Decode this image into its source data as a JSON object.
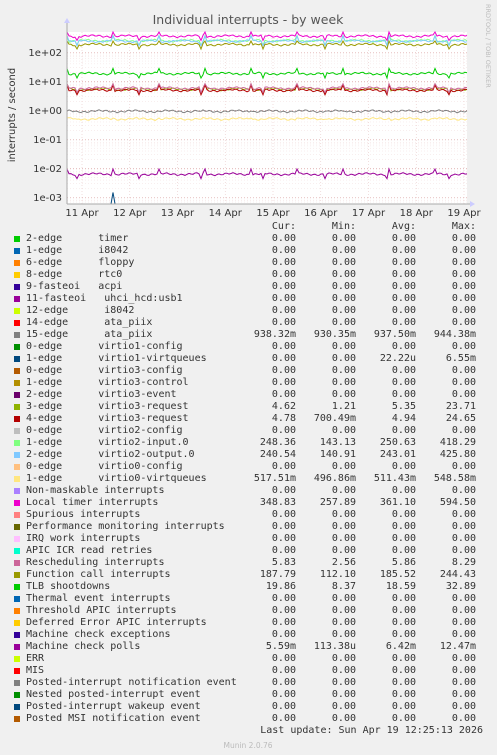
{
  "chart_data": {
    "type": "line",
    "title": "Individual interrupts - by week",
    "ylabel": "interrupts / second",
    "yscale": "log",
    "ylim": [
      0.0006,
      500
    ],
    "y_ticks": [
      {
        "value": 100,
        "label": "1e+02"
      },
      {
        "value": 10,
        "label": "1e+01"
      },
      {
        "value": 1,
        "label": "1e+00"
      },
      {
        "value": 0.1,
        "label": "1e-01"
      },
      {
        "value": 0.01,
        "label": "1e-02"
      },
      {
        "value": 0.001,
        "label": "1e-03"
      }
    ],
    "x_ticks": [
      "11 Apr",
      "12 Apr",
      "13 Apr",
      "14 Apr",
      "15 Apr",
      "16 Apr",
      "17 Apr",
      "18 Apr",
      "19 Apr"
    ],
    "grid": true,
    "side_label": "RRDTOOL / TOBI OETIKER",
    "columns": [
      "Cur:",
      "Min:",
      "Avg:",
      "Max:"
    ],
    "series": [
      {
        "name": "2-edge      timer",
        "color": "#00cc00",
        "values": [
          "0.00",
          "0.00",
          "0.00",
          "0.00"
        ]
      },
      {
        "name": "1-edge      i8042",
        "color": "#0066b3",
        "values": [
          "0.00",
          "0.00",
          "0.00",
          "0.00"
        ]
      },
      {
        "name": "6-edge      floppy",
        "color": "#ff8000",
        "values": [
          "0.00",
          "0.00",
          "0.00",
          "0.00"
        ]
      },
      {
        "name": "8-edge      rtc0",
        "color": "#ffcc00",
        "values": [
          "0.00",
          "0.00",
          "0.00",
          "0.00"
        ]
      },
      {
        "name": "9-fasteoi   acpi",
        "color": "#330099",
        "values": [
          "0.00",
          "0.00",
          "0.00",
          "0.00"
        ]
      },
      {
        "name": "11-fasteoi   uhci_hcd:usb1",
        "color": "#990099",
        "values": [
          "0.00",
          "0.00",
          "0.00",
          "0.00"
        ]
      },
      {
        "name": "12-edge      i8042",
        "color": "#ccff00",
        "values": [
          "0.00",
          "0.00",
          "0.00",
          "0.00"
        ]
      },
      {
        "name": "14-edge      ata_piix",
        "color": "#ff0000",
        "values": [
          "0.00",
          "0.00",
          "0.00",
          "0.00"
        ]
      },
      {
        "name": "15-edge      ata_piix",
        "color": "#808080",
        "values": [
          "938.32m",
          "930.35m",
          "937.50m",
          "944.38m"
        ]
      },
      {
        "name": "0-edge      virtio1-config",
        "color": "#008f00",
        "values": [
          "0.00",
          "0.00",
          "0.00",
          "0.00"
        ]
      },
      {
        "name": "1-edge      virtio1-virtqueues",
        "color": "#00487d",
        "values": [
          "0.00",
          "0.00",
          "22.22u",
          "6.55m"
        ]
      },
      {
        "name": "0-edge      virtio3-config",
        "color": "#b35a00",
        "values": [
          "0.00",
          "0.00",
          "0.00",
          "0.00"
        ]
      },
      {
        "name": "1-edge      virtio3-control",
        "color": "#b38f00",
        "values": [
          "0.00",
          "0.00",
          "0.00",
          "0.00"
        ]
      },
      {
        "name": "2-edge      virtio3-event",
        "color": "#6b006b",
        "values": [
          "0.00",
          "0.00",
          "0.00",
          "0.00"
        ]
      },
      {
        "name": "3-edge      virtio3-request",
        "color": "#8fb300",
        "values": [
          "4.62",
          "1.21",
          "5.35",
          "23.71"
        ]
      },
      {
        "name": "4-edge      virtio3-request",
        "color": "#b30000",
        "values": [
          "4.78",
          "700.49m",
          "4.94",
          "24.65"
        ]
      },
      {
        "name": "0-edge      virtio2-config",
        "color": "#bebebe",
        "values": [
          "0.00",
          "0.00",
          "0.00",
          "0.00"
        ]
      },
      {
        "name": "1-edge      virtio2-input.0",
        "color": "#80ff80",
        "values": [
          "248.36",
          "143.13",
          "250.63",
          "418.29"
        ]
      },
      {
        "name": "2-edge      virtio2-output.0",
        "color": "#80c9ff",
        "values": [
          "240.54",
          "140.91",
          "243.01",
          "425.80"
        ]
      },
      {
        "name": "0-edge      virtio0-config",
        "color": "#ffc080",
        "values": [
          "0.00",
          "0.00",
          "0.00",
          "0.00"
        ]
      },
      {
        "name": "1-edge      virtio0-virtqueues",
        "color": "#ffe680",
        "values": [
          "517.51m",
          "496.86m",
          "511.43m",
          "548.58m"
        ]
      },
      {
        "name": "Non-maskable interrupts",
        "color": "#aa80ff",
        "values": [
          "0.00",
          "0.00",
          "0.00",
          "0.00"
        ]
      },
      {
        "name": "Local timer interrupts",
        "color": "#ee00cc",
        "values": [
          "348.83",
          "257.89",
          "361.10",
          "594.50"
        ]
      },
      {
        "name": "Spurious interrupts",
        "color": "#ff8080",
        "values": [
          "0.00",
          "0.00",
          "0.00",
          "0.00"
        ]
      },
      {
        "name": "Performance monitoring interrupts",
        "color": "#666600",
        "values": [
          "0.00",
          "0.00",
          "0.00",
          "0.00"
        ]
      },
      {
        "name": "IRQ work interrupts",
        "color": "#ffbfff",
        "values": [
          "0.00",
          "0.00",
          "0.00",
          "0.00"
        ]
      },
      {
        "name": "APIC ICR read retries",
        "color": "#00ffcc",
        "values": [
          "0.00",
          "0.00",
          "0.00",
          "0.00"
        ]
      },
      {
        "name": "Rescheduling interrupts",
        "color": "#cc6699",
        "values": [
          "5.83",
          "2.56",
          "5.86",
          "8.29"
        ]
      },
      {
        "name": "Function call interrupts",
        "color": "#999900",
        "values": [
          "187.79",
          "112.10",
          "185.52",
          "244.43"
        ]
      },
      {
        "name": "TLB shootdowns",
        "color": "#00cc00",
        "values": [
          "19.86",
          "8.37",
          "18.59",
          "32.89"
        ]
      },
      {
        "name": "Thermal event interrupts",
        "color": "#0066b3",
        "values": [
          "0.00",
          "0.00",
          "0.00",
          "0.00"
        ]
      },
      {
        "name": "Threshold APIC interrupts",
        "color": "#ff8000",
        "values": [
          "0.00",
          "0.00",
          "0.00",
          "0.00"
        ]
      },
      {
        "name": "Deferred Error APIC interrupts",
        "color": "#ffcc00",
        "values": [
          "0.00",
          "0.00",
          "0.00",
          "0.00"
        ]
      },
      {
        "name": "Machine check exceptions",
        "color": "#330099",
        "values": [
          "0.00",
          "0.00",
          "0.00",
          "0.00"
        ]
      },
      {
        "name": "Machine check polls",
        "color": "#990099",
        "values": [
          "5.59m",
          "113.38u",
          "6.42m",
          "12.47m"
        ]
      },
      {
        "name": "ERR",
        "color": "#ccff00",
        "values": [
          "0.00",
          "0.00",
          "0.00",
          "0.00"
        ]
      },
      {
        "name": "MIS",
        "color": "#ff0000",
        "values": [
          "0.00",
          "0.00",
          "0.00",
          "0.00"
        ]
      },
      {
        "name": "Posted-interrupt notification event",
        "color": "#808080",
        "values": [
          "0.00",
          "0.00",
          "0.00",
          "0.00"
        ]
      },
      {
        "name": "Nested posted-interrupt event",
        "color": "#008f00",
        "values": [
          "0.00",
          "0.00",
          "0.00",
          "0.00"
        ]
      },
      {
        "name": "Posted-interrupt wakeup event",
        "color": "#00487d",
        "values": [
          "0.00",
          "0.00",
          "0.00",
          "0.00"
        ]
      },
      {
        "name": "Posted MSI notification event",
        "color": "#b35a00",
        "values": [
          "0.00",
          "0.00",
          "0.00",
          "0.00"
        ]
      }
    ]
  },
  "last_update": "Last update: Sun Apr 19 12:25:13 2026",
  "footer": "Munin 2.0.76"
}
